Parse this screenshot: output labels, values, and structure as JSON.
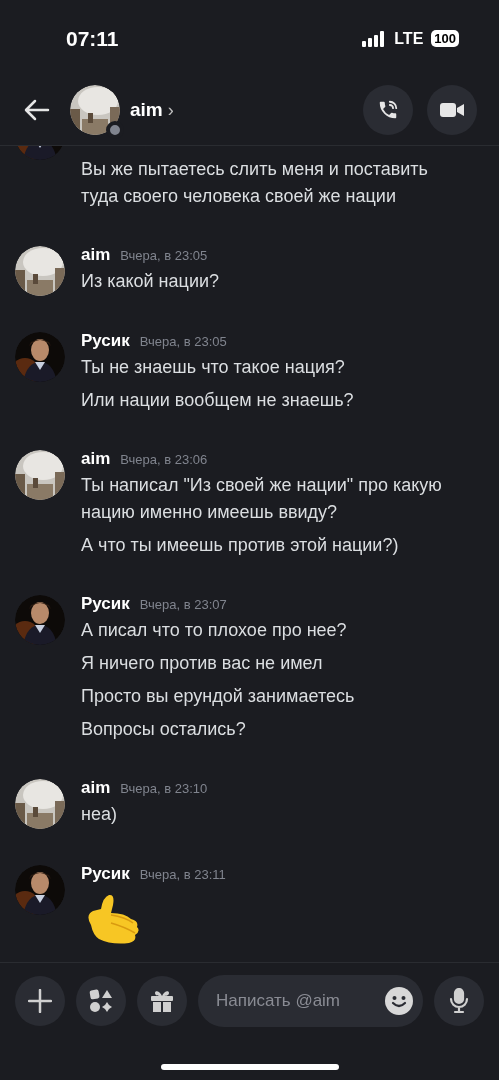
{
  "status_bar": {
    "time": "07:11",
    "network": "LTE",
    "battery": "100"
  },
  "header": {
    "title": "aim",
    "chevron": "›",
    "online": false
  },
  "groups": [
    {
      "messages": [
        {
          "kind": "text",
          "text": "Вы же пытаетесь слить меня и поставить туда своего человека своей же нации"
        }
      ]
    },
    {
      "author": "aim",
      "time": "Вчера, в 23:05",
      "messages": [
        {
          "kind": "text",
          "text": "Из какой нации?"
        }
      ]
    },
    {
      "author": "Русик",
      "time": "Вчера, в 23:05",
      "messages": [
        {
          "kind": "text",
          "text": "Ты не знаешь что такое нация?"
        },
        {
          "kind": "text",
          "text": "Или нации вообщем не знаешь?"
        }
      ]
    },
    {
      "author": "aim",
      "time": "Вчера, в 23:06",
      "messages": [
        {
          "kind": "text",
          "text": "Ты написал \"Из своей же нации\" про какую нацию именно имеешь ввиду?"
        },
        {
          "kind": "text",
          "text": "А что ты имеешь против этой нации?)"
        }
      ]
    },
    {
      "author": "Русик",
      "time": "Вчера, в 23:07",
      "messages": [
        {
          "kind": "text",
          "text": "А писал что то плохое про нее?"
        },
        {
          "kind": "text",
          "text": "Я ничего против вас не имел"
        },
        {
          "kind": "text",
          "text": "Просто вы ерундой занимаетесь"
        },
        {
          "kind": "text",
          "text": "Вопросы остались?"
        }
      ]
    },
    {
      "author": "aim",
      "time": "Вчера, в 23:10",
      "messages": [
        {
          "kind": "text",
          "text": "неа)"
        }
      ]
    },
    {
      "author": "Русик",
      "time": "Вчера, в 23:11",
      "messages": [
        {
          "kind": "emoji"
        }
      ]
    }
  ],
  "composer": {
    "placeholder": "Написать @aim"
  }
}
